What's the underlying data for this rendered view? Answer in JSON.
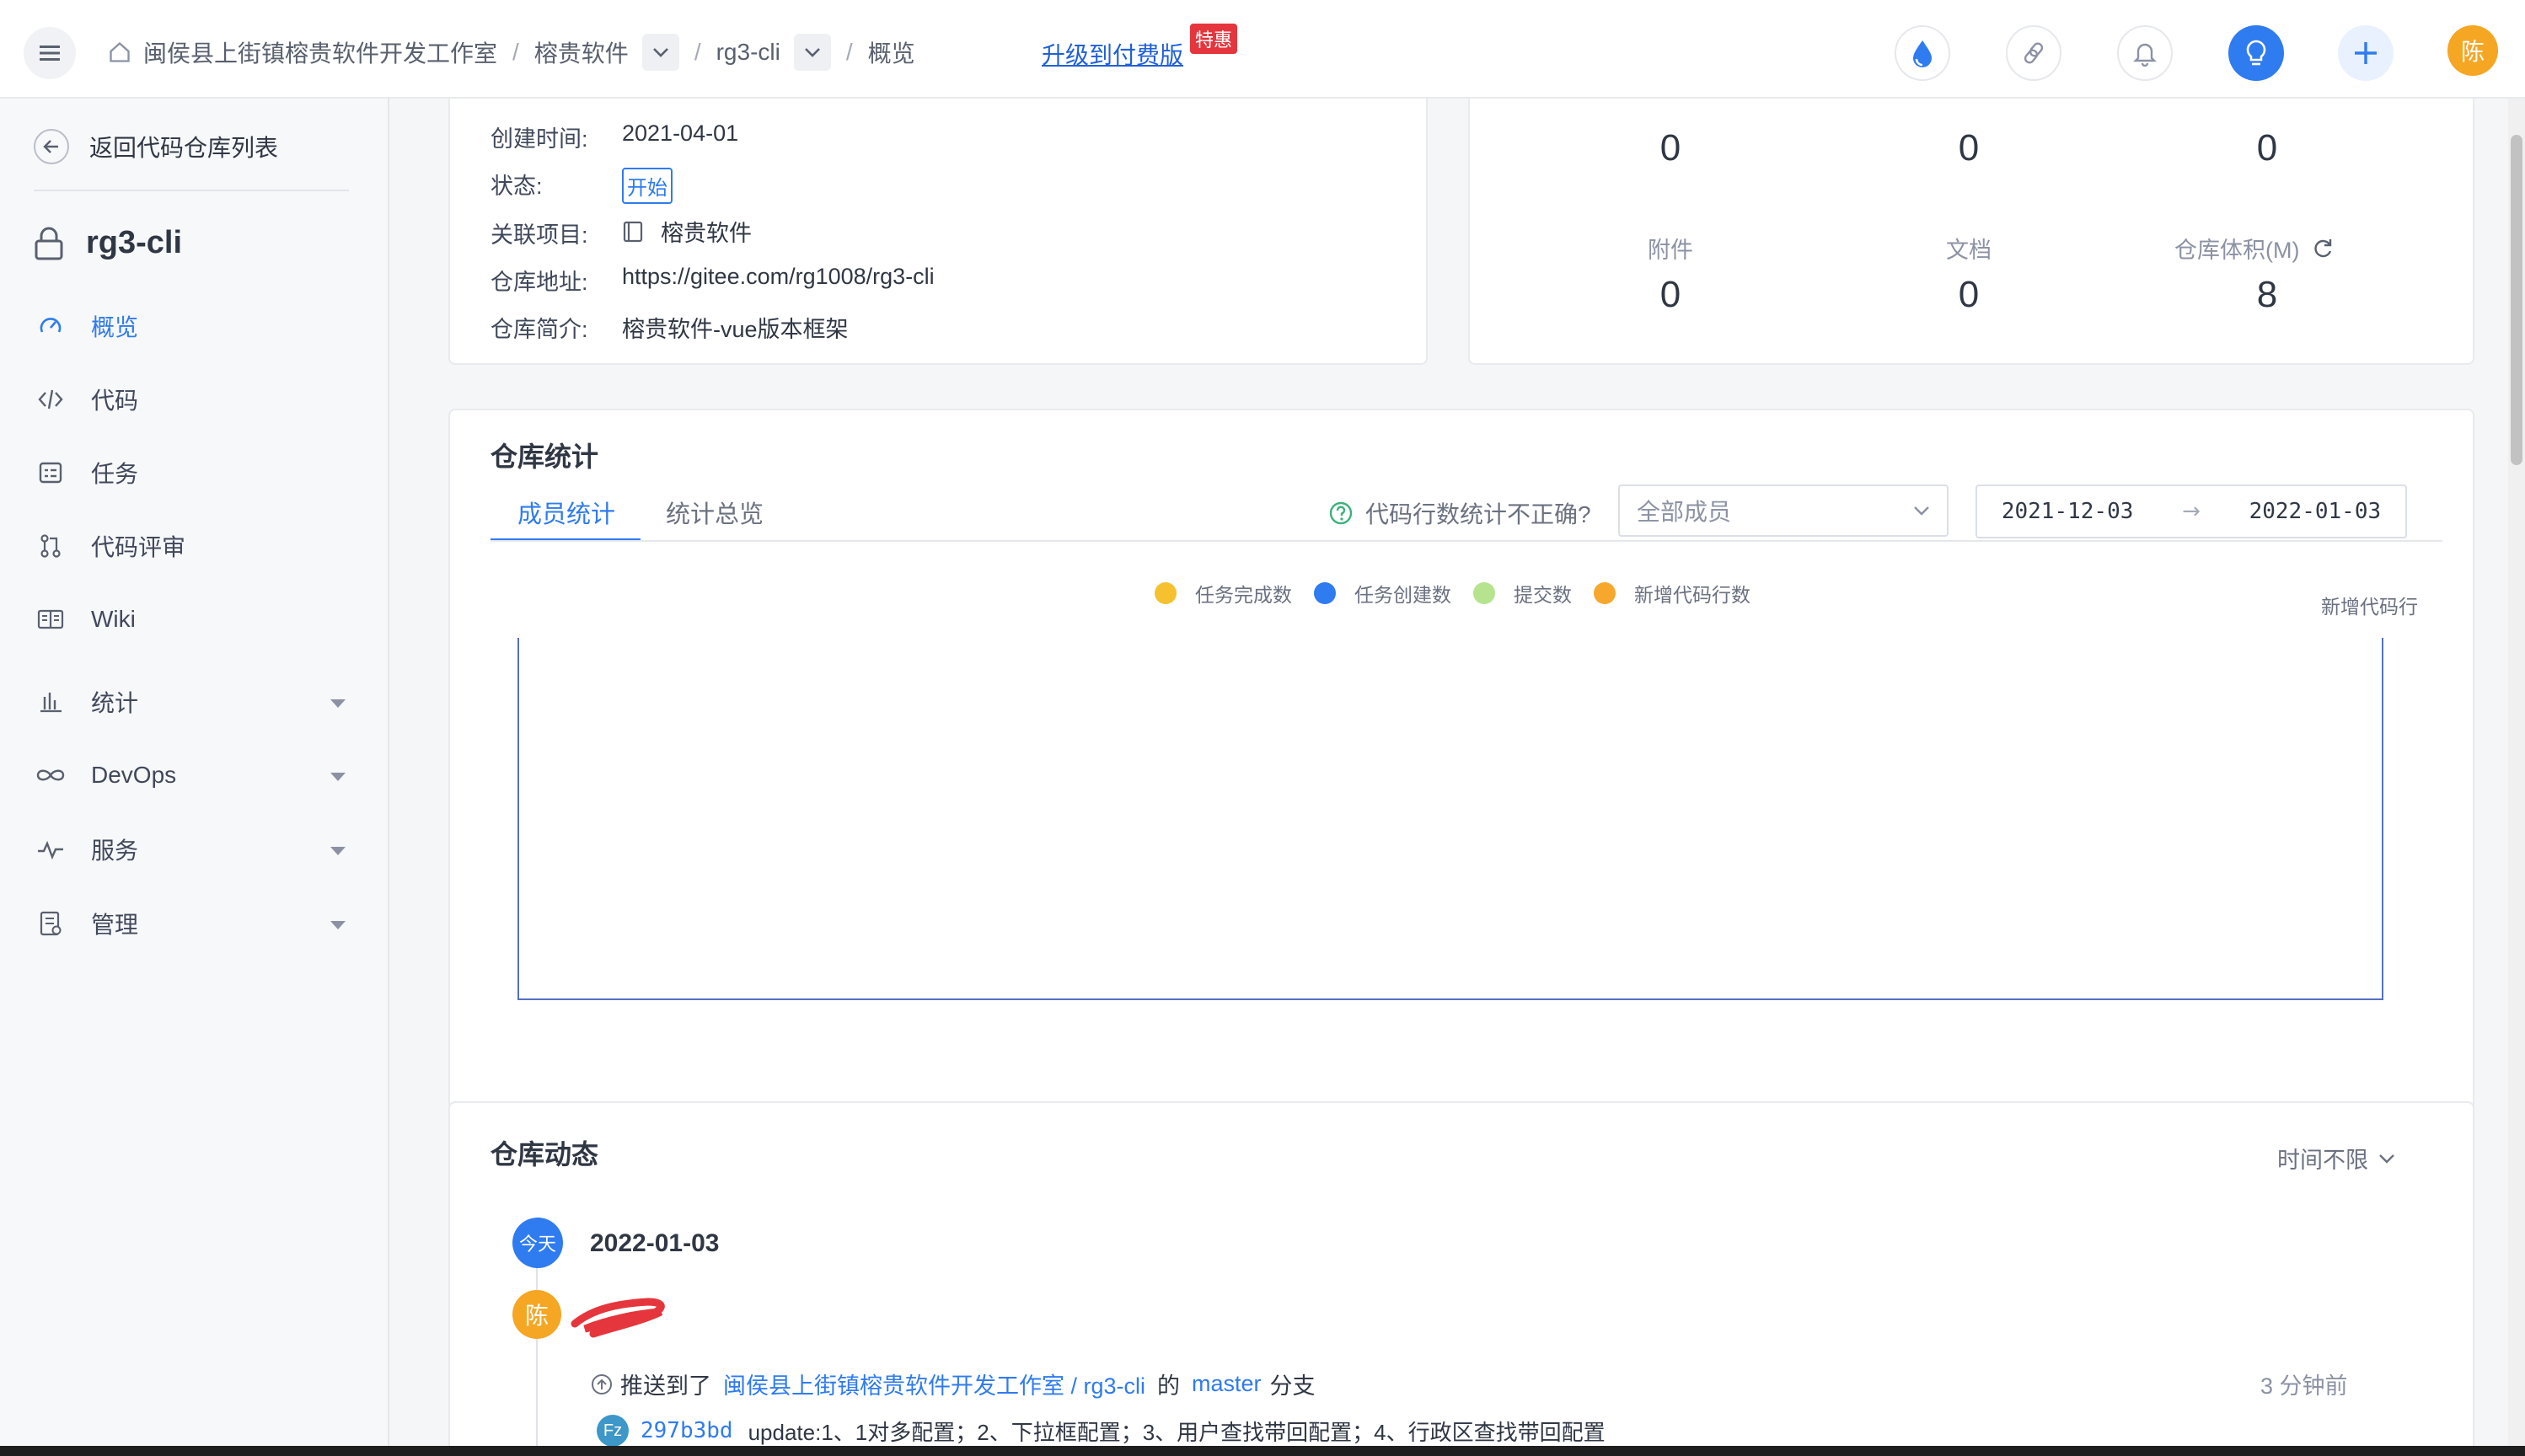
{
  "header": {
    "breadcrumb_org": "闽侯县上街镇榕贵软件开发工作室",
    "breadcrumb_sep": "/",
    "breadcrumb_project": "榕贵软件",
    "breadcrumb_repo": "rg3-cli",
    "breadcrumb_page": "概览",
    "upgrade_link": "升级到付费版",
    "upgrade_badge": "特惠",
    "avatar_char": "陈"
  },
  "sidebar": {
    "back_label": "返回代码仓库列表",
    "repo_name": "rg3-cli",
    "items": [
      {
        "label": "概览",
        "icon": "dashboard-icon",
        "active": true
      },
      {
        "label": "代码",
        "icon": "code-icon"
      },
      {
        "label": "任务",
        "icon": "task-icon"
      },
      {
        "label": "代码评审",
        "icon": "review-icon"
      },
      {
        "label": "Wiki",
        "icon": "wiki-icon"
      },
      {
        "label": "统计",
        "icon": "chart-icon",
        "expandable": true
      },
      {
        "label": "DevOps",
        "icon": "infinity-icon",
        "expandable": true
      },
      {
        "label": "服务",
        "icon": "pulse-icon",
        "expandable": true
      },
      {
        "label": "管理",
        "icon": "manage-icon",
        "expandable": true
      }
    ]
  },
  "info": {
    "created_label": "创建时间:",
    "created_value": "2021-04-01",
    "status_label": "状态:",
    "status_value": "开始",
    "project_label": "关联项目:",
    "project_value": "榕贵软件",
    "address_label": "仓库地址:",
    "address_value": "https://gitee.com/rg1008/rg3-cli",
    "desc_label": "仓库简介:",
    "desc_value": "榕贵软件-vue版本框架"
  },
  "stats": {
    "top_values": [
      "0",
      "0",
      "0"
    ],
    "items": [
      {
        "label": "附件",
        "value": "0"
      },
      {
        "label": "文档",
        "value": "0"
      },
      {
        "label": "仓库体积(M)",
        "value": "8"
      }
    ]
  },
  "repo_stats": {
    "title": "仓库统计",
    "tabs": [
      "成员统计",
      "统计总览"
    ],
    "hint": "代码行数统计不正确?",
    "member_select": "全部成员",
    "date_from": "2021-12-03",
    "date_arrow": "→",
    "date_to": "2022-01-03",
    "legend": [
      {
        "name": "任务完成数",
        "color": "#f5c12e"
      },
      {
        "name": "任务创建数",
        "color": "#2f7bf0"
      },
      {
        "name": "提交数",
        "color": "#b5e38e"
      },
      {
        "name": "新增代码行数",
        "color": "#f7a72c"
      }
    ],
    "right_axis_label": "新增代码行"
  },
  "activity": {
    "title": "仓库动态",
    "filter": "时间不限",
    "today_badge": "今天",
    "date": "2022-01-03",
    "avatar_char": "陈",
    "pushed_text": "推送到了",
    "repo_link": "闽侯县上街镇榕贵软件开发工作室 / rg3-cli",
    "of_text": "的",
    "branch": "master",
    "branch_suffix": "分支",
    "time_ago": "3 分钟前",
    "commit_avatar": "Fz",
    "commit_hash": "297b3bd",
    "commit_message": "update:1、1对多配置；2、下拉框配置；3、用户查找带回配置；4、行政区查找带回配置"
  },
  "colors": {
    "accent": "#2f7bf0",
    "avatar_orange": "#f5a623",
    "badge_red": "#e5353d"
  }
}
